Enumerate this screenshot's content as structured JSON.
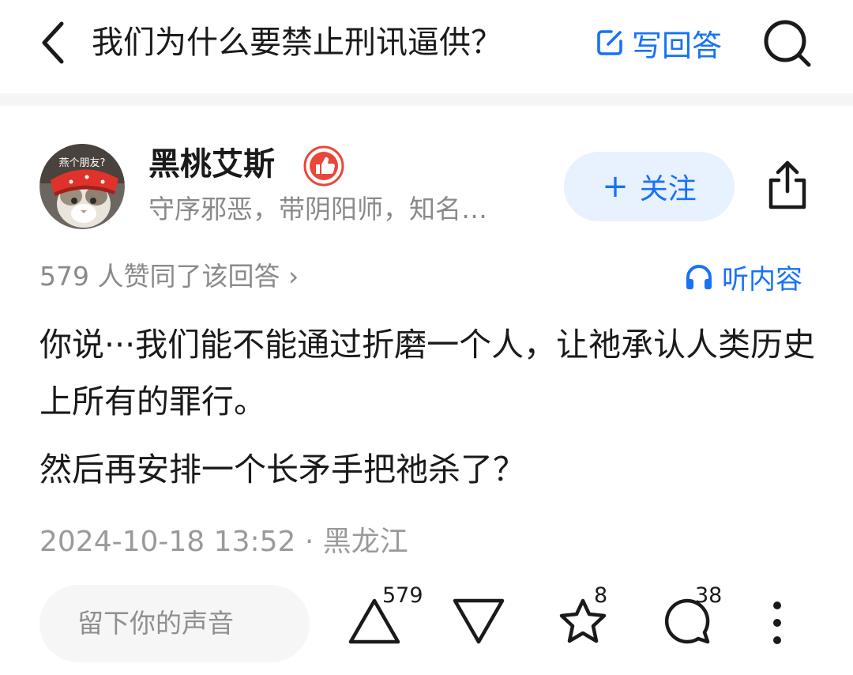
{
  "header": {
    "title": "我们为什么要禁止刑讯逼供？",
    "write_answer_label": "写回答",
    "back_icon": "chevron-left-icon",
    "search_icon": "search-icon"
  },
  "author": {
    "name": "黑桃艾斯",
    "bio": "守序邪恶，带阴阳师，知名…",
    "avatar_caption": "燕个朋友?",
    "follow_label": "关注",
    "follow_plus": "+"
  },
  "answer": {
    "vote_summary": "579 人赞同了该回答 ›",
    "listen_label": "听内容",
    "paragraphs": [
      "你说···我们能不能通过折磨一个人，让祂承认人类历史上所有的罪行。",
      "然后再安排一个长矛手把祂杀了？"
    ],
    "timestamp": "2024-10-18 13:52 · 黑龙江"
  },
  "bottom_bar": {
    "comment_placeholder": "留下你的声音",
    "upvote_count": "579",
    "favorite_count": "8",
    "comment_count": "38"
  },
  "colors": {
    "accent": "#1772f6",
    "follow_bg": "#e8f1fe",
    "badge_red": "#e8473a"
  }
}
